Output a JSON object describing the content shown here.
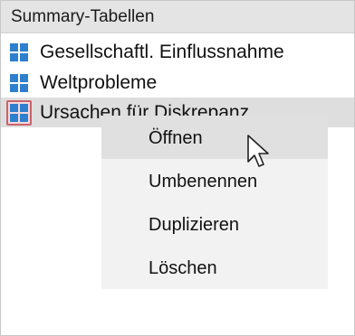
{
  "panel": {
    "title": "Summary-Tabellen"
  },
  "tree": {
    "items": [
      {
        "label": "Gesellschaftl. Einflussnahme",
        "icon": "table-grid-icon"
      },
      {
        "label": "Weltprobleme",
        "icon": "table-grid-icon"
      },
      {
        "label": "Ursachen für Diskrepanz",
        "icon": "table-grid-icon",
        "selected": true
      }
    ]
  },
  "context_menu": {
    "items": [
      {
        "label": "Öffnen",
        "hover": true
      },
      {
        "label": "Umbenennen"
      },
      {
        "label": "Duplizieren"
      },
      {
        "label": "Löschen"
      }
    ]
  },
  "colors": {
    "icon_blue": "#2f7fcf",
    "selection_border": "#c9636b",
    "header_bg": "#e4e4e4",
    "menu_bg": "#f2f2f2"
  }
}
